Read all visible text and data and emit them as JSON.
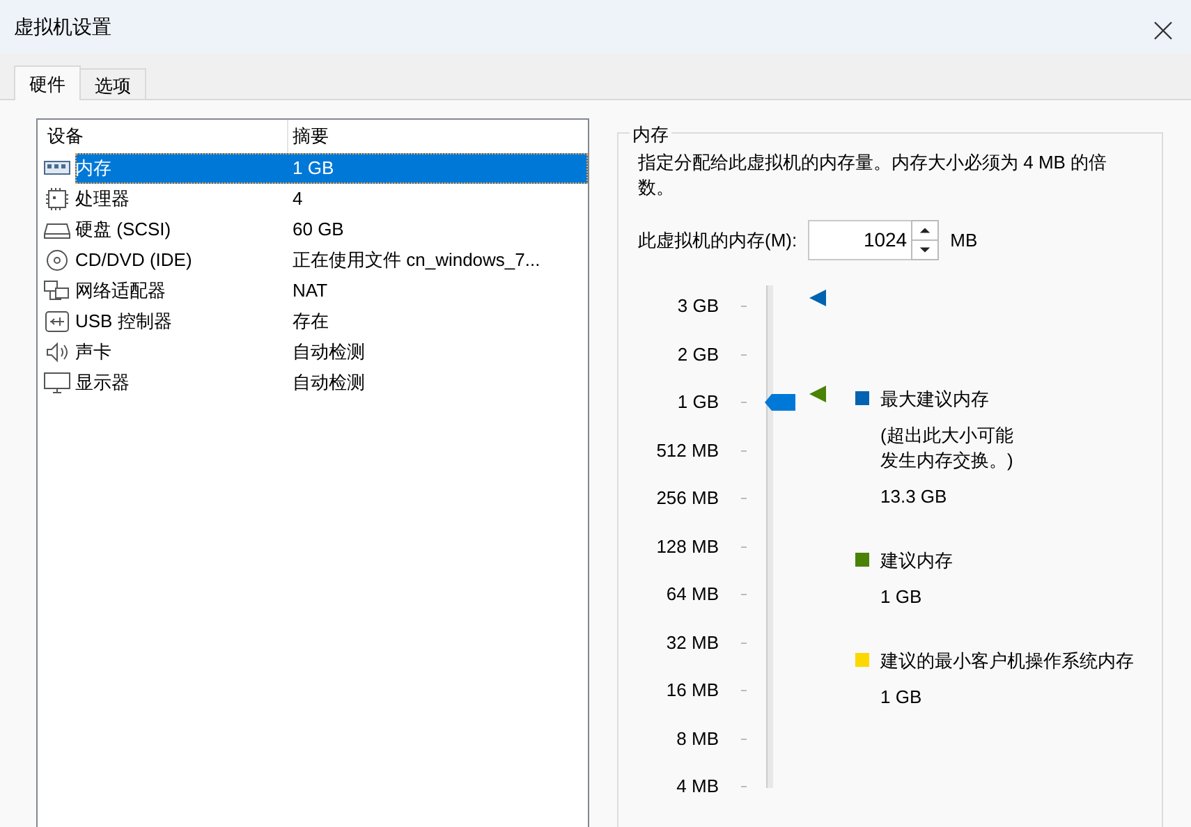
{
  "window": {
    "title": "虚拟机设置"
  },
  "tabs": [
    {
      "label": "硬件",
      "selected": true
    },
    {
      "label": "选项",
      "selected": false
    }
  ],
  "device_table": {
    "columns": [
      "设备",
      "摘要"
    ],
    "rows": [
      {
        "device": "内存",
        "summary": "1 GB",
        "selected": true
      },
      {
        "device": "处理器",
        "summary": "4",
        "selected": false
      },
      {
        "device": "硬盘 (SCSI)",
        "summary": "60 GB",
        "selected": false
      },
      {
        "device": "CD/DVD (IDE)",
        "summary": "正在使用文件 cn_windows_7...",
        "selected": false
      },
      {
        "device": "网络适配器",
        "summary": "NAT",
        "selected": false
      },
      {
        "device": "USB 控制器",
        "summary": "存在",
        "selected": false
      },
      {
        "device": "声卡",
        "summary": "自动检测",
        "selected": false
      },
      {
        "device": "显示器",
        "summary": "自动检测",
        "selected": false
      }
    ]
  },
  "memory_panel": {
    "title": "内存",
    "description": "指定分配给此虚拟机的内存量。内存大小必须为 4 MB 的倍数。",
    "memory_field": {
      "label": "此虚拟机的内存(M):",
      "value": "1024",
      "unit": "MB"
    },
    "slider": {
      "ticks": [
        "3 GB",
        "2 GB",
        "1 GB",
        "512 MB",
        "256 MB",
        "128 MB",
        "64 MB",
        "32 MB",
        "16 MB",
        "8 MB",
        "4 MB"
      ],
      "level": 0.8,
      "markers": [
        {
          "color": "#0063b1",
          "level": 1.0
        },
        {
          "color": "#498205",
          "level": 0.8
        }
      ]
    },
    "legend": [
      {
        "label": "最大建议内存",
        "note": "(超出此大小可能发生内存交换。)",
        "value": "13.3 GB",
        "color": "#0063b1"
      },
      {
        "label": "建议内存",
        "value": "1 GB",
        "color": "#498205"
      },
      {
        "label": "建议的最小客户机操作系统内存",
        "value": "1 GB",
        "color": "#fcd800"
      }
    ]
  }
}
